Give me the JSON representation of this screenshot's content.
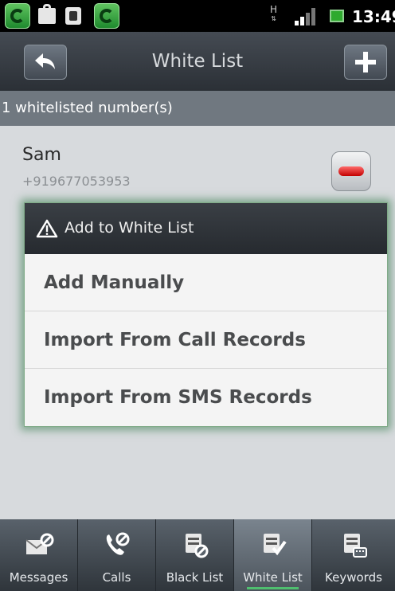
{
  "status_bar": {
    "time": "13:49",
    "network_type": "H"
  },
  "title_bar": {
    "title": "White List",
    "back_icon": "back-arrow-icon",
    "add_icon": "plus-icon"
  },
  "subheader": {
    "count_text": "1 whitelisted number(s)"
  },
  "contacts": [
    {
      "name": "Sam",
      "number": "+919677053953"
    }
  ],
  "dialog": {
    "title": "Add to White List",
    "options": [
      "Add Manually",
      "Import From Call Records",
      "Import From SMS Records"
    ]
  },
  "bottom_nav": {
    "items": [
      {
        "label": "Messages",
        "icon": "message-block-icon"
      },
      {
        "label": "Calls",
        "icon": "phone-block-icon"
      },
      {
        "label": "Black List",
        "icon": "blacklist-icon"
      },
      {
        "label": "White List",
        "icon": "whitelist-icon"
      },
      {
        "label": "Keywords",
        "icon": "keywords-icon"
      }
    ],
    "active": "White List"
  },
  "colors": {
    "accent_green": "#4fbf6f",
    "remove_red": "#d40000"
  }
}
